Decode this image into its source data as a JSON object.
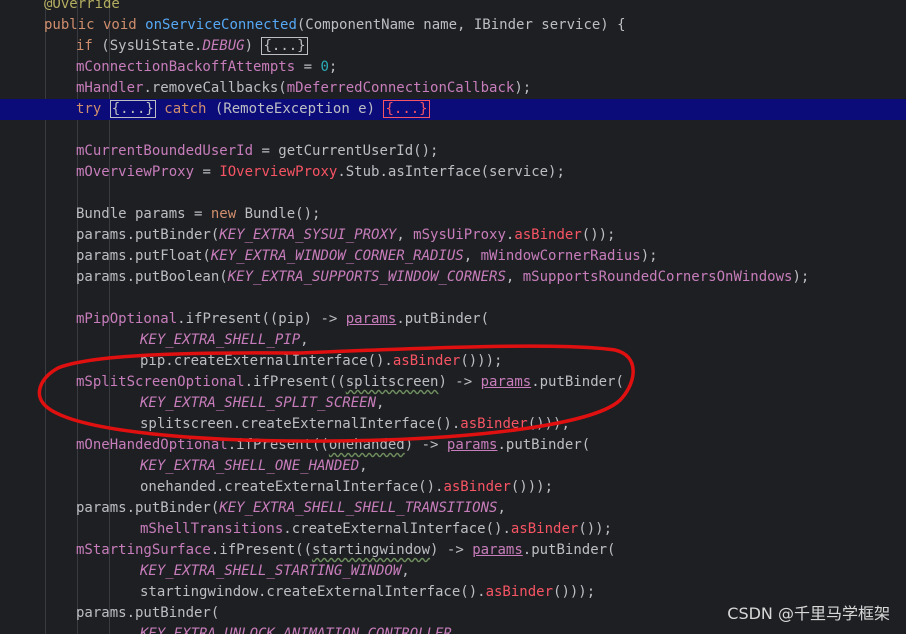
{
  "watermark": "CSDN @千里马学框架",
  "highlight_color": "#0b0b7a",
  "annotation_color": "#e01010",
  "lines": [
    [
      [
        "ann",
        "@Override"
      ]
    ],
    [
      [
        "kw",
        "public void "
      ],
      [
        "fn",
        "onServiceConnected"
      ],
      [
        "plain",
        "(ComponentName name, IBinder service) {"
      ]
    ],
    [
      [
        "kw",
        "if "
      ],
      [
        "plain",
        "(SysUiState."
      ],
      [
        "const",
        "DEBUG"
      ],
      [
        "plain",
        ") "
      ],
      [
        "fold",
        "{...}"
      ]
    ],
    [
      [
        "field",
        "mConnectionBackoffAttempts"
      ],
      [
        "plain",
        " = "
      ],
      [
        "num",
        "0"
      ],
      [
        "plain",
        ";"
      ]
    ],
    [
      [
        "field",
        "mHandler"
      ],
      [
        "plain",
        ".removeCallbacks("
      ],
      [
        "field",
        "mDeferredConnectionCallback"
      ],
      [
        "plain",
        ");"
      ]
    ],
    [
      [
        "kw",
        "try "
      ],
      [
        "fold",
        "{...}"
      ],
      [
        "kw",
        " catch "
      ],
      [
        "plain",
        "(RemoteException e) "
      ],
      [
        "foldred",
        "{...}"
      ]
    ],
    [],
    [
      [
        "field",
        "mCurrentBoundedUserId"
      ],
      [
        "plain",
        " = getCurrentUserId();"
      ]
    ],
    [
      [
        "field",
        "mOverviewProxy"
      ],
      [
        "plain",
        " = "
      ],
      [
        "err",
        "IOverviewProxy"
      ],
      [
        "plain",
        ".Stub.asInterface(service);"
      ]
    ],
    [],
    [
      [
        "plain",
        "Bundle params = "
      ],
      [
        "kw",
        "new "
      ],
      [
        "plain",
        "Bundle();"
      ]
    ],
    [
      [
        "plain",
        "params.putBinder("
      ],
      [
        "const",
        "KEY_EXTRA_SYSUI_PROXY"
      ],
      [
        "plain",
        ", "
      ],
      [
        "field",
        "mSysUiProxy"
      ],
      [
        "plain",
        "."
      ],
      [
        "err",
        "asBinder"
      ],
      [
        "plain",
        "());"
      ]
    ],
    [
      [
        "plain",
        "params.putFloat("
      ],
      [
        "const",
        "KEY_EXTRA_WINDOW_CORNER_RADIUS"
      ],
      [
        "plain",
        ", "
      ],
      [
        "field",
        "mWindowCornerRadius"
      ],
      [
        "plain",
        ");"
      ]
    ],
    [
      [
        "plain",
        "params.putBoolean("
      ],
      [
        "const",
        "KEY_EXTRA_SUPPORTS_WINDOW_CORNERS"
      ],
      [
        "plain",
        ", "
      ],
      [
        "field",
        "mSupportsRoundedCornersOnWindows"
      ],
      [
        "plain",
        ");"
      ]
    ],
    [],
    [
      [
        "field",
        "mPipOptional"
      ],
      [
        "plain",
        ".ifPresent((pip) -> "
      ],
      [
        "ref",
        "params"
      ],
      [
        "plain",
        ".putBinder("
      ]
    ],
    [
      [
        "const",
        "KEY_EXTRA_SHELL_PIP"
      ],
      [
        "plain",
        ","
      ]
    ],
    [
      [
        "plain",
        "pip.createExternalInterface()."
      ],
      [
        "err",
        "asBinder"
      ],
      [
        "plain",
        "()));"
      ]
    ],
    [
      [
        "field",
        "mSplitScreenOptional"
      ],
      [
        "plain",
        ".ifPresent(("
      ],
      [
        "squig",
        "splitscreen"
      ],
      [
        "plain",
        ") -> "
      ],
      [
        "ref",
        "params"
      ],
      [
        "plain",
        ".putBinder("
      ]
    ],
    [
      [
        "const",
        "KEY_EXTRA_SHELL_SPLIT_SCREEN"
      ],
      [
        "plain",
        ","
      ]
    ],
    [
      [
        "plain",
        "splitscreen.createExternalInterface()."
      ],
      [
        "err",
        "asBinder"
      ],
      [
        "plain",
        "()));"
      ]
    ],
    [
      [
        "field",
        "mOneHandedOptional"
      ],
      [
        "plain",
        ".ifPresent(("
      ],
      [
        "squig",
        "onehanded"
      ],
      [
        "plain",
        ") -> "
      ],
      [
        "ref",
        "params"
      ],
      [
        "plain",
        ".putBinder("
      ]
    ],
    [
      [
        "const",
        "KEY_EXTRA_SHELL_ONE_HANDED"
      ],
      [
        "plain",
        ","
      ]
    ],
    [
      [
        "plain",
        "onehanded.createExternalInterface()."
      ],
      [
        "err",
        "asBinder"
      ],
      [
        "plain",
        "()));"
      ]
    ],
    [
      [
        "plain",
        "params.putBinder("
      ],
      [
        "const",
        "KEY_EXTRA_SHELL_SHELL_TRANSITIONS"
      ],
      [
        "plain",
        ","
      ]
    ],
    [
      [
        "field",
        "mShellTransitions"
      ],
      [
        "plain",
        ".createExternalInterface()."
      ],
      [
        "err",
        "asBinder"
      ],
      [
        "plain",
        "());"
      ]
    ],
    [
      [
        "field",
        "mStartingSurface"
      ],
      [
        "plain",
        ".ifPresent(("
      ],
      [
        "squig",
        "startingwindow"
      ],
      [
        "plain",
        ") -> "
      ],
      [
        "ref",
        "params"
      ],
      [
        "plain",
        ".putBinder("
      ]
    ],
    [
      [
        "const",
        "KEY_EXTRA_SHELL_STARTING_WINDOW"
      ],
      [
        "plain",
        ","
      ]
    ],
    [
      [
        "plain",
        "startingwindow.createExternalInterface()."
      ],
      [
        "err",
        "asBinder"
      ],
      [
        "plain",
        "()));"
      ]
    ],
    [
      [
        "plain",
        "params.putBinder("
      ]
    ],
    [
      [
        "const",
        "KEY_EXTRA_UNLOCK_ANIMATION_CONTROLLER"
      ],
      [
        "plain",
        ","
      ]
    ]
  ]
}
